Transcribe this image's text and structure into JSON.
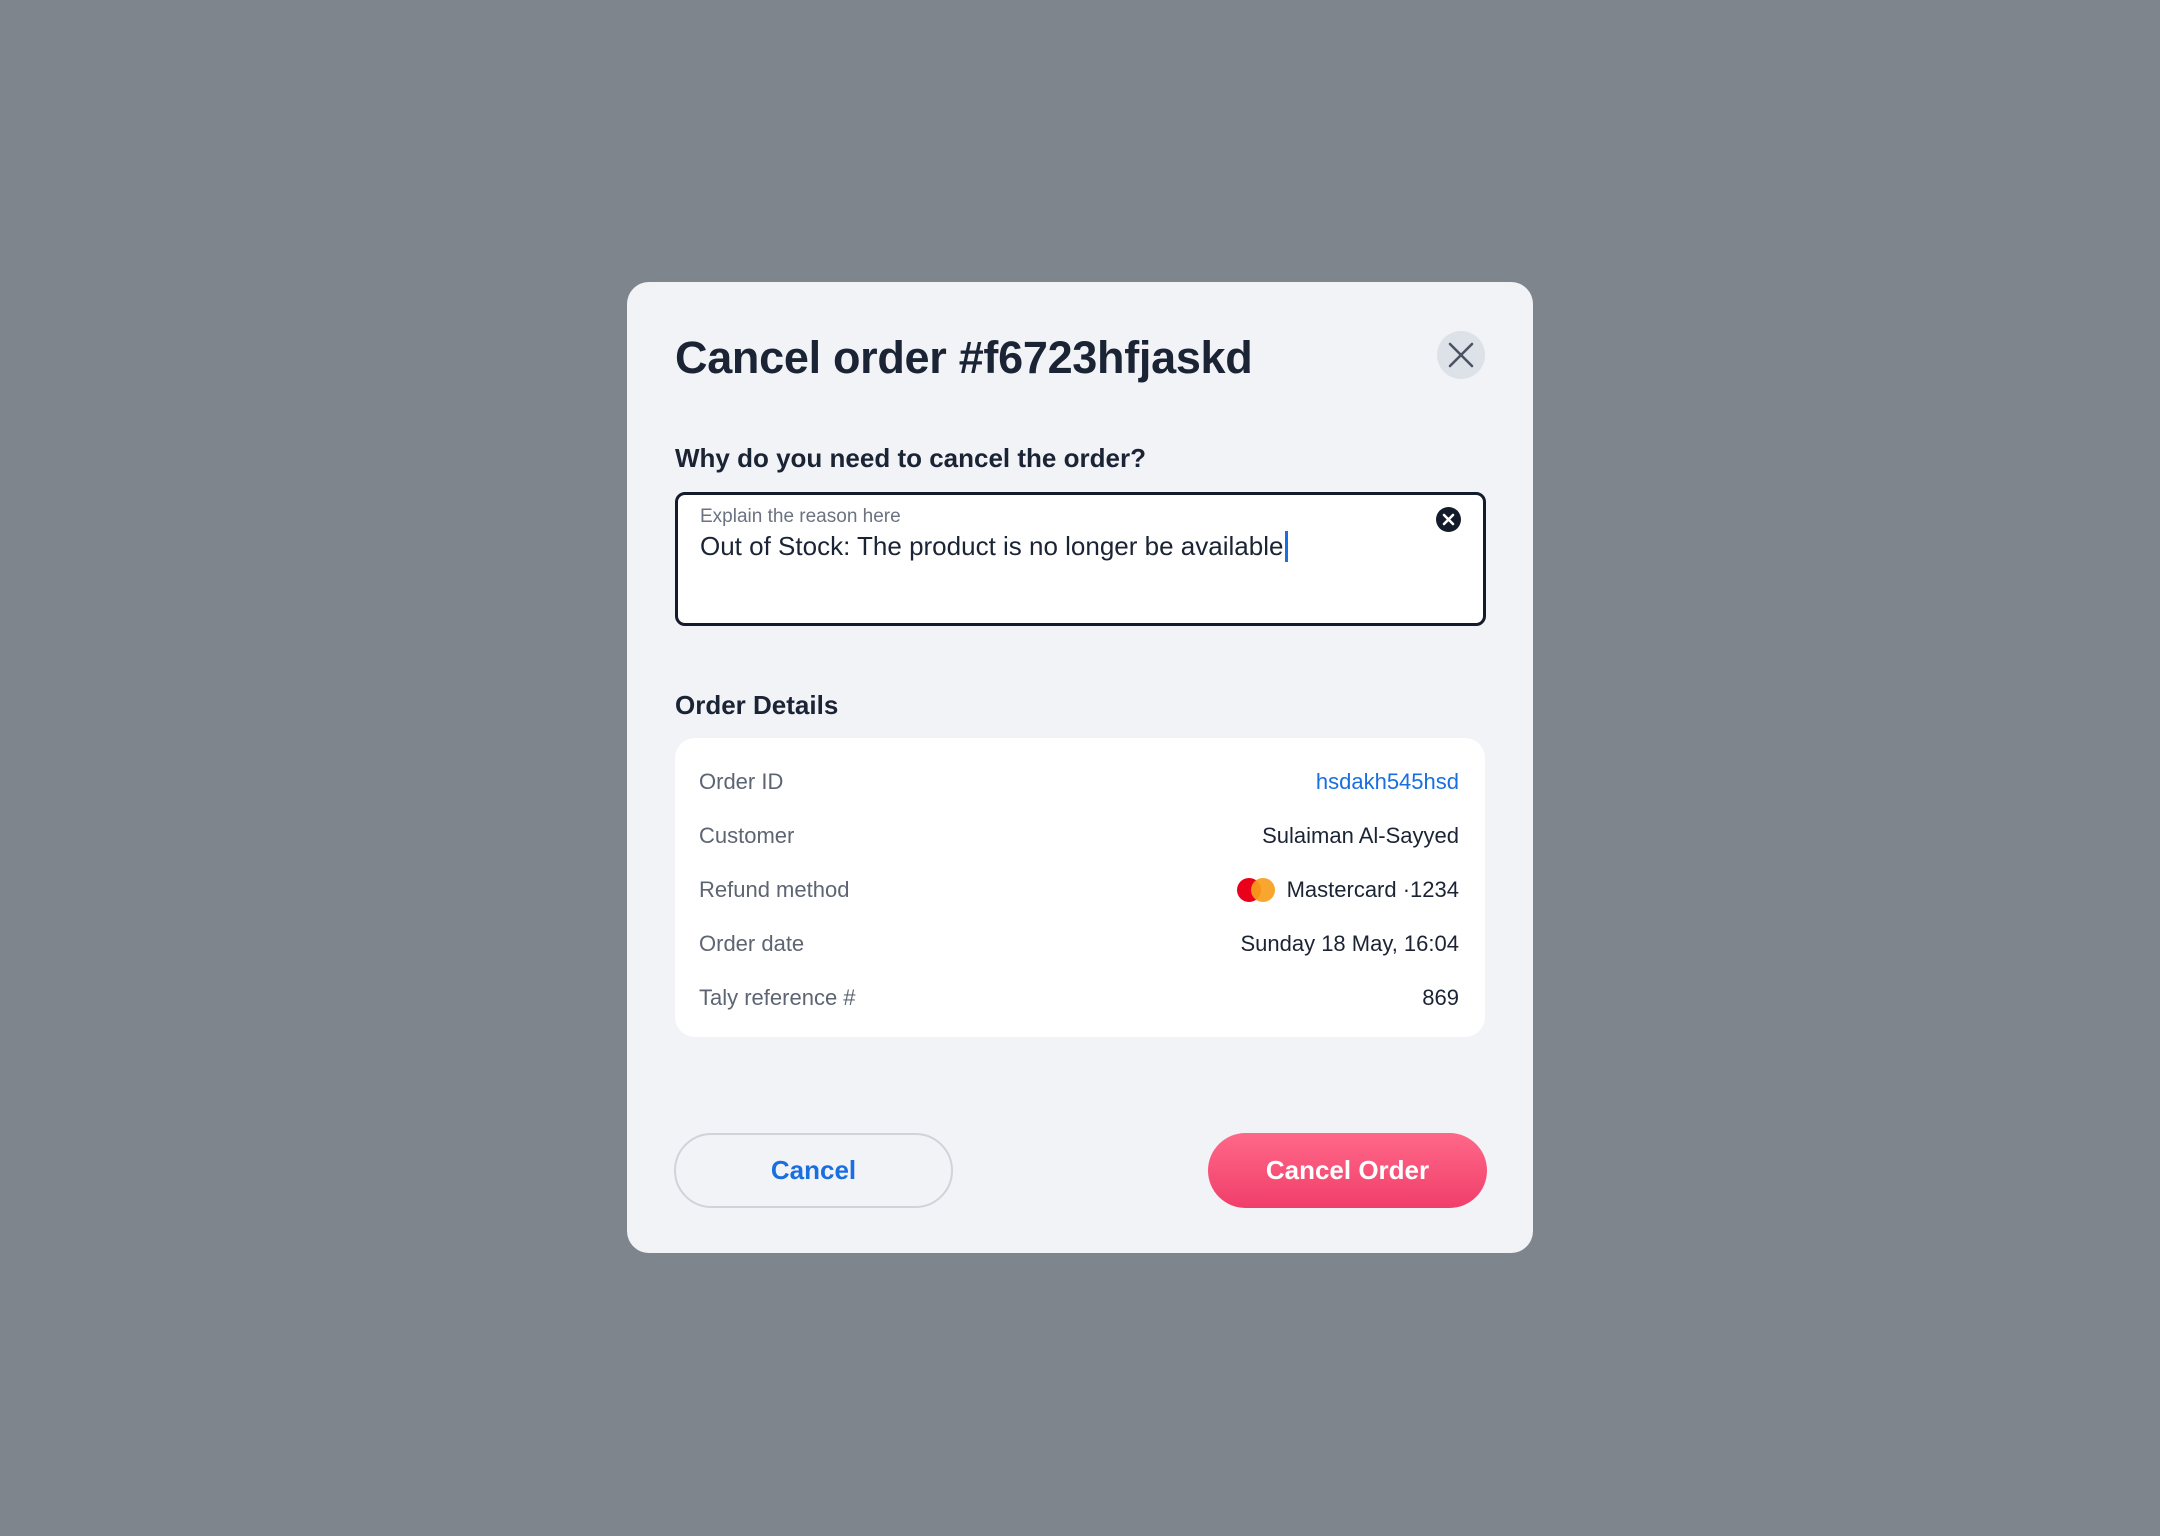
{
  "modal": {
    "title": "Cancel order #f6723hfjaskd",
    "close_icon": "close-icon"
  },
  "reason": {
    "question": "Why do you need to cancel the order?",
    "placeholder": "Explain the reason here",
    "value": "Out of Stock: The product is no longer be available",
    "clear_icon": "clear-circle-icon"
  },
  "order_details": {
    "title": "Order Details",
    "rows": [
      {
        "label": "Order ID",
        "value": "hsdakh545hsd"
      },
      {
        "label": "Customer",
        "value": "Sulaiman Al-Sayyed"
      },
      {
        "label": "Refund method",
        "value": "Mastercard ·1234",
        "icon": "mastercard-logo"
      },
      {
        "label": "Order date",
        "value": "Sunday 18 May, 16:04"
      },
      {
        "label": "Taly reference #",
        "value": "869"
      }
    ]
  },
  "actions": {
    "cancel_label": "Cancel",
    "confirm_label": "Cancel Order"
  },
  "colors": {
    "backdrop": "#7f858d",
    "modal_bg": "#f1f3f7",
    "link": "#1a6fe0",
    "danger": "#f03e6a",
    "text_primary": "#1b2434",
    "text_secondary": "#5d6573"
  }
}
